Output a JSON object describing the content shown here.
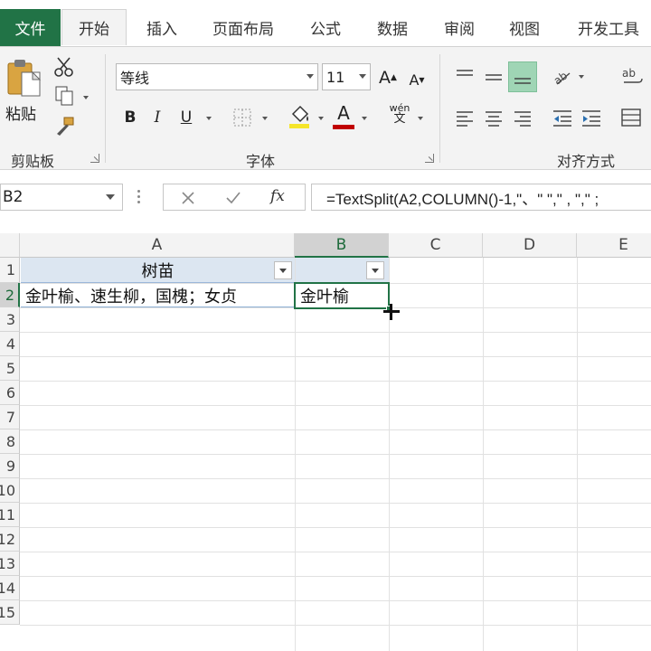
{
  "tabs": {
    "file": "文件",
    "items": [
      "开始",
      "插入",
      "页面布局",
      "公式",
      "数据",
      "审阅",
      "视图",
      "开发工具"
    ]
  },
  "ribbon": {
    "clipboard": {
      "paste_label": "粘贴",
      "group_label": "剪贴板"
    },
    "font": {
      "font_name": "等线",
      "font_size": "11",
      "bold": "B",
      "italic": "I",
      "underline": "U",
      "grow": "A",
      "shrink": "A",
      "font_color": "A",
      "phonetic": "wén",
      "group_label": "字体"
    },
    "alignment": {
      "group_label": "对齐方式"
    },
    "colors": {
      "highlight": "#f5e52a",
      "font_color": "#c00000",
      "accent": "#217346"
    }
  },
  "formula_bar": {
    "name_box": "B2",
    "fx": "fx",
    "formula": "=TextSplit(A2,COLUMN()-1,\"、\" \",\" , \",\" ;"
  },
  "grid": {
    "columns": [
      "A",
      "B",
      "C",
      "D",
      "E"
    ],
    "rows": [
      "1",
      "2",
      "3",
      "4",
      "5",
      "6",
      "7",
      "8",
      "9",
      "10",
      "11",
      "12",
      "13",
      "14",
      "15"
    ],
    "cells": {
      "A1": "树苗",
      "A2": "金叶榆、速生柳，国槐；女贞",
      "B2": "金叶榆"
    },
    "selected_cell": "B2"
  }
}
